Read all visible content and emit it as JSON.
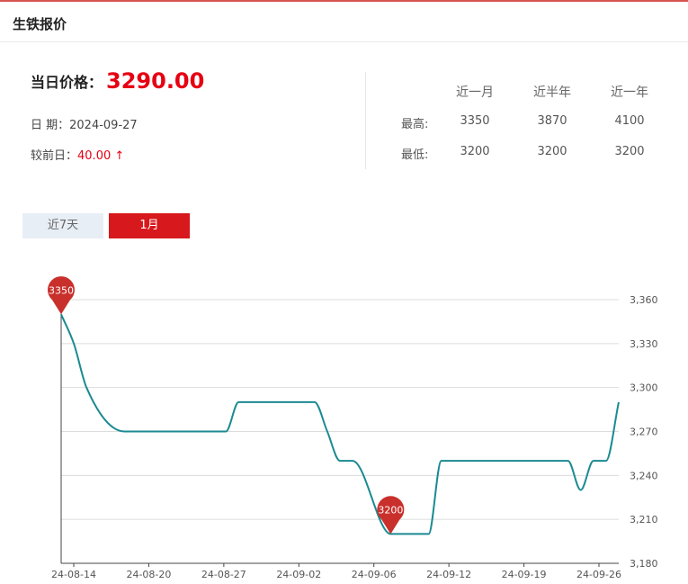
{
  "header": {
    "title": "生铁报价"
  },
  "price": {
    "label": "当日价格：",
    "value": "3290.00",
    "date_text": "日  期：2024-09-27",
    "change_label": "较前日：",
    "change_value": "40.00 ↑"
  },
  "stats": {
    "headers": [
      "近一月",
      "近半年",
      "近一年"
    ],
    "rows": [
      {
        "label": "最高:",
        "values": [
          "3350",
          "3870",
          "4100"
        ]
      },
      {
        "label": "最低:",
        "values": [
          "3200",
          "3200",
          "3200"
        ]
      }
    ]
  },
  "tabs": [
    {
      "label": "近7天",
      "active": false
    },
    {
      "label": "1月",
      "active": true
    }
  ],
  "colors": {
    "accent": "#d7181c",
    "line": "#1b8a92",
    "pin": "#c9302c"
  },
  "chart_data": {
    "type": "line",
    "x_tick_labels": [
      "24-08-14",
      "24-08-20",
      "24-08-27",
      "24-09-02",
      "24-09-06",
      "24-09-12",
      "24-09-19",
      "24-09-26"
    ],
    "y_tick_labels": [
      "3,360",
      "3,330",
      "3,300",
      "3,270",
      "3,240",
      "3,210",
      "3,180"
    ],
    "ylim": [
      3180,
      3360
    ],
    "y_ticks": [
      3360,
      3330,
      3300,
      3270,
      3240,
      3210,
      3180
    ],
    "x": [
      "2024-08-14",
      "2024-08-15",
      "2024-08-16",
      "2024-08-19",
      "2024-08-20",
      "2024-08-21",
      "2024-08-22",
      "2024-08-23",
      "2024-08-26",
      "2024-08-27",
      "2024-08-28",
      "2024-08-29",
      "2024-08-30",
      "2024-09-02",
      "2024-09-03",
      "2024-09-04",
      "2024-09-05",
      "2024-09-06",
      "2024-09-09",
      "2024-09-10",
      "2024-09-11",
      "2024-09-12",
      "2024-09-13",
      "2024-09-18",
      "2024-09-19",
      "2024-09-20",
      "2024-09-23",
      "2024-09-24",
      "2024-09-25",
      "2024-09-26",
      "2024-09-27"
    ],
    "values": [
      3350,
      3330,
      3300,
      3270,
      3270,
      3270,
      3270,
      3270,
      3270,
      3270,
      3290,
      3290,
      3290,
      3290,
      3290,
      3270,
      3250,
      3250,
      3200,
      3200,
      3200,
      3200,
      3250,
      3250,
      3250,
      3250,
      3250,
      3230,
      3250,
      3250,
      3290
    ],
    "annotations": [
      {
        "label": "3350",
        "index": 0
      },
      {
        "label": "3200",
        "index": 18
      }
    ],
    "grid": true
  }
}
